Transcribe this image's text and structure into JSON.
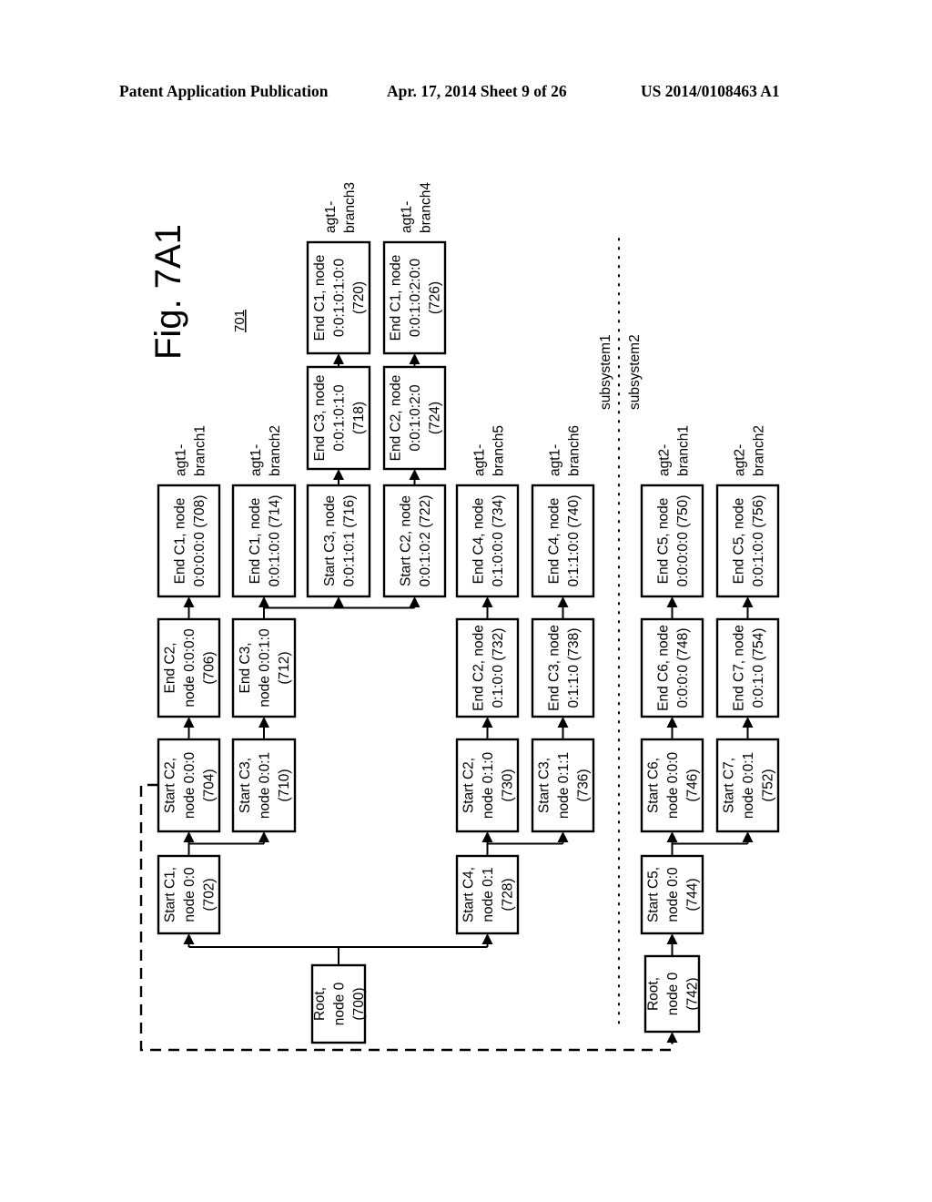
{
  "header": {
    "left": "Patent Application Publication",
    "middle": "Apr. 17, 2014  Sheet 9 of 26",
    "right": "US 2014/0108463 A1"
  },
  "figure": {
    "title": "Fig. 7A1",
    "reference": "701",
    "subsystem_labels": [
      "subsystem1",
      "subsystem2"
    ],
    "nodes": [
      {
        "id": "700",
        "lines": [
          "Root,",
          "node 0",
          "(700)"
        ]
      },
      {
        "id": "702",
        "lines": [
          "Start C1,",
          "node 0:0",
          "(702)"
        ]
      },
      {
        "id": "704",
        "lines": [
          "Start C2,",
          "node 0:0:0",
          "(704)"
        ]
      },
      {
        "id": "706",
        "lines": [
          "End C2,",
          "node 0:0:0:0",
          "(706)"
        ]
      },
      {
        "id": "708",
        "lines": [
          "End C1, node",
          "0:0:0:0:0 (708)"
        ]
      },
      {
        "id": "710",
        "lines": [
          "Start C3,",
          "node 0:0:1",
          "(710)"
        ]
      },
      {
        "id": "712",
        "lines": [
          "End C3,",
          "node 0:0:1:0",
          "(712)"
        ]
      },
      {
        "id": "714",
        "lines": [
          "End C1, node",
          "0:0:1:0:0 (714)"
        ]
      },
      {
        "id": "716",
        "lines": [
          "Start C3, node",
          "0:0:1:0:1 (716)"
        ]
      },
      {
        "id": "718",
        "lines": [
          "End C3, node",
          "0:0:1:0:1:0",
          "(718)"
        ]
      },
      {
        "id": "720",
        "lines": [
          "End C1, node",
          "0:0:1:0:1:0:0",
          "(720)"
        ]
      },
      {
        "id": "722",
        "lines": [
          "Start C2, node",
          "0:0:1:0:2 (722)"
        ]
      },
      {
        "id": "724",
        "lines": [
          "End C2, node",
          "0:0:1:0:2:0",
          "(724)"
        ]
      },
      {
        "id": "726",
        "lines": [
          "End C1, node",
          "0:0:1:0:2:0:0",
          "(726)"
        ]
      },
      {
        "id": "728",
        "lines": [
          "Start C4,",
          "node 0:1",
          "(728)"
        ]
      },
      {
        "id": "730",
        "lines": [
          "Start C2,",
          "node 0:1:0",
          "(730)"
        ]
      },
      {
        "id": "732",
        "lines": [
          "End C2, node",
          "0:1:0:0 (732)"
        ]
      },
      {
        "id": "734",
        "lines": [
          "End C4, node",
          "0:1:0:0:0 (734)"
        ]
      },
      {
        "id": "736",
        "lines": [
          "Start C3,",
          "node 0:1:1",
          "(736)"
        ]
      },
      {
        "id": "738",
        "lines": [
          "End C3, node",
          "0:1:1:0 (738)"
        ]
      },
      {
        "id": "740",
        "lines": [
          "End C4, node",
          "0:1:1:0:0 (740)"
        ]
      },
      {
        "id": "742",
        "lines": [
          "Root,",
          "node 0",
          "(742)"
        ]
      },
      {
        "id": "744",
        "lines": [
          "Start C5,",
          "node 0:0",
          "(744)"
        ]
      },
      {
        "id": "746",
        "lines": [
          "Start C6,",
          "node 0:0:0",
          "(746)"
        ]
      },
      {
        "id": "748",
        "lines": [
          "End C6, node",
          "0:0:0:0 (748)"
        ]
      },
      {
        "id": "750",
        "lines": [
          "End C5, node",
          "0:0:0:0:0 (750)"
        ]
      },
      {
        "id": "752",
        "lines": [
          "Start C7,",
          "node 0:0:1",
          "(752)"
        ]
      },
      {
        "id": "754",
        "lines": [
          "End C7, node",
          "0:0:1:0 (754)"
        ]
      },
      {
        "id": "756",
        "lines": [
          "End C5, node",
          "0:0:1:0:0 (756)"
        ]
      }
    ],
    "branch_labels": [
      {
        "anchor": "708",
        "lines": [
          "agt1-",
          "branch1"
        ]
      },
      {
        "anchor": "714",
        "lines": [
          "agt1-",
          "branch2"
        ]
      },
      {
        "anchor": "720",
        "lines": [
          "agt1-",
          "branch3"
        ]
      },
      {
        "anchor": "726",
        "lines": [
          "agt1-",
          "branch4"
        ]
      },
      {
        "anchor": "734",
        "lines": [
          "agt1-",
          "branch5"
        ]
      },
      {
        "anchor": "740",
        "lines": [
          "agt1-",
          "branch6"
        ]
      },
      {
        "anchor": "750",
        "lines": [
          "agt2-",
          "branch1"
        ]
      },
      {
        "anchor": "756",
        "lines": [
          "agt2-",
          "branch2"
        ]
      }
    ],
    "edges": [
      [
        "700",
        "702"
      ],
      [
        "700",
        "728"
      ],
      [
        "702",
        "704"
      ],
      [
        "702",
        "710"
      ],
      [
        "704",
        "706"
      ],
      [
        "706",
        "708"
      ],
      [
        "710",
        "712"
      ],
      [
        "712",
        "714"
      ],
      [
        "712",
        "716"
      ],
      [
        "712",
        "722"
      ],
      [
        "716",
        "718"
      ],
      [
        "718",
        "720"
      ],
      [
        "722",
        "724"
      ],
      [
        "724",
        "726"
      ],
      [
        "728",
        "730"
      ],
      [
        "728",
        "736"
      ],
      [
        "730",
        "732"
      ],
      [
        "732",
        "734"
      ],
      [
        "736",
        "738"
      ],
      [
        "738",
        "740"
      ],
      [
        "742",
        "744"
      ],
      [
        "744",
        "746"
      ],
      [
        "744",
        "752"
      ],
      [
        "746",
        "748"
      ],
      [
        "748",
        "750"
      ],
      [
        "752",
        "754"
      ],
      [
        "754",
        "756"
      ]
    ],
    "cross_subsystem_link": {
      "from": "704",
      "to": "742",
      "style": "dashed"
    }
  }
}
